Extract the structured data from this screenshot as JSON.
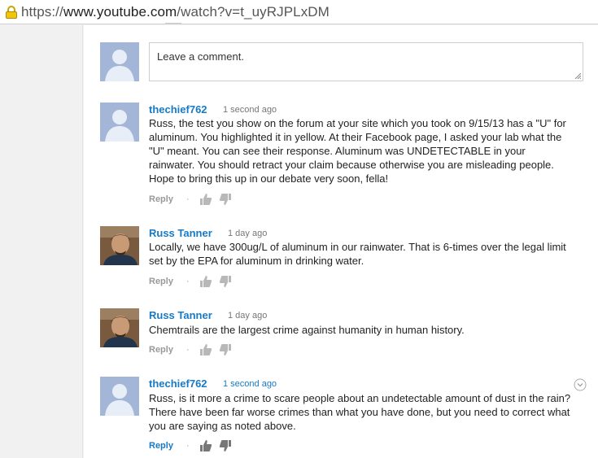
{
  "browser": {
    "url_proto": "https://",
    "url_host": "www.youtube.com",
    "url_path": "/watch?v=t_uyRJPLxDM"
  },
  "comment_box": {
    "placeholder": "Leave a comment."
  },
  "comments": [
    {
      "author": "thechief762",
      "time": "1 second ago",
      "text": "Russ, the test you show on the forum at your site which you took on 9/15/13 has a \"U\" for aluminum. You highlighted it in yellow. At their Facebook page, I asked your lab what the \"U\" meant. You can see their response. Aluminum was UNDETECTABLE in your rainwater. You should retract your claim because otherwise you are misleading people. Hope to bring this up in our debate very soon, fella!",
      "reply": "Reply",
      "dot": "·"
    },
    {
      "author": "Russ Tanner",
      "time": "1 day ago",
      "text": "Locally, we have 300ug/L of aluminum in our rainwater. That is 6-times over the legal limit set by the EPA for aluminum in drinking water.",
      "reply": "Reply",
      "dot": "·"
    },
    {
      "author": "Russ Tanner",
      "time": "1 day ago",
      "text": "Chemtrails are the largest crime against humanity in human history.",
      "reply": "Reply",
      "dot": "·"
    },
    {
      "author": "thechief762",
      "time": "1 second ago",
      "text": "Russ, is it more a crime to scare people about an undetectable amount of dust in the rain? There have been far worse crimes than what you have done, but you need to correct what you are saying as noted above.",
      "reply": "Reply",
      "dot": "·"
    }
  ],
  "colors": {
    "link": "#167ac6",
    "muted": "#767676",
    "avatar_generic": "#a4b6d8"
  },
  "icons": [
    "lock-icon",
    "default-avatar",
    "user-photo",
    "thumbs-up-icon",
    "thumbs-down-icon",
    "resize-handle-icon",
    "comment-menu-icon"
  ]
}
